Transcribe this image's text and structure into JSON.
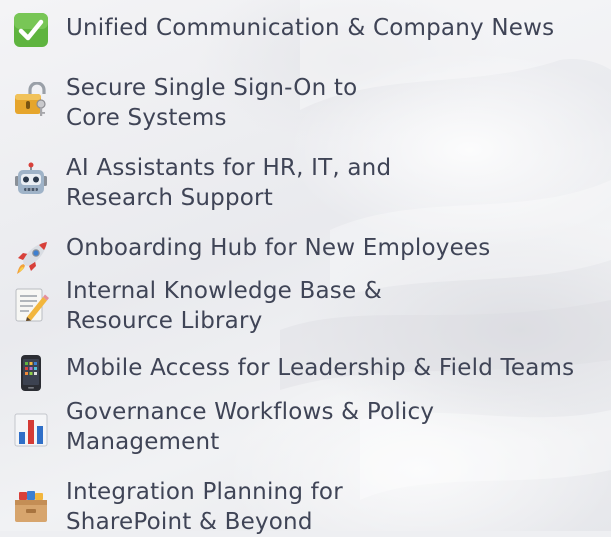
{
  "features": [
    {
      "icon": "check-mark-icon",
      "lines": [
        "Unified Communication & Company News"
      ]
    },
    {
      "icon": "lock-key-icon",
      "lines": [
        "Secure Single Sign-On to",
        "Core Systems"
      ]
    },
    {
      "icon": "robot-icon",
      "lines": [
        "AI Assistants for HR, IT, and",
        "Research Support"
      ]
    },
    {
      "icon": "rocket-icon",
      "lines": [
        "Onboarding Hub for New Employees"
      ]
    },
    {
      "icon": "memo-icon",
      "lines": [
        "Internal Knowledge Base &",
        "Resource Library"
      ]
    },
    {
      "icon": "mobile-phone-icon",
      "lines": [
        "Mobile Access for Leadership & Field Teams"
      ]
    },
    {
      "icon": "bar-chart-icon",
      "lines": [
        "Governance Workflows & Policy",
        "Management"
      ]
    },
    {
      "icon": "card-file-box-icon",
      "lines": [
        "Integration Planning for",
        "SharePoint & Beyond"
      ]
    }
  ],
  "colors": {
    "text": "#3f4456",
    "check_green": "#5fb43f",
    "lock_gold": "#e6a52c",
    "rocket_red": "#d8403a",
    "chart_blue": "#2f6fc8",
    "chart_red": "#d43b36",
    "box_tan": "#d7a56d"
  }
}
